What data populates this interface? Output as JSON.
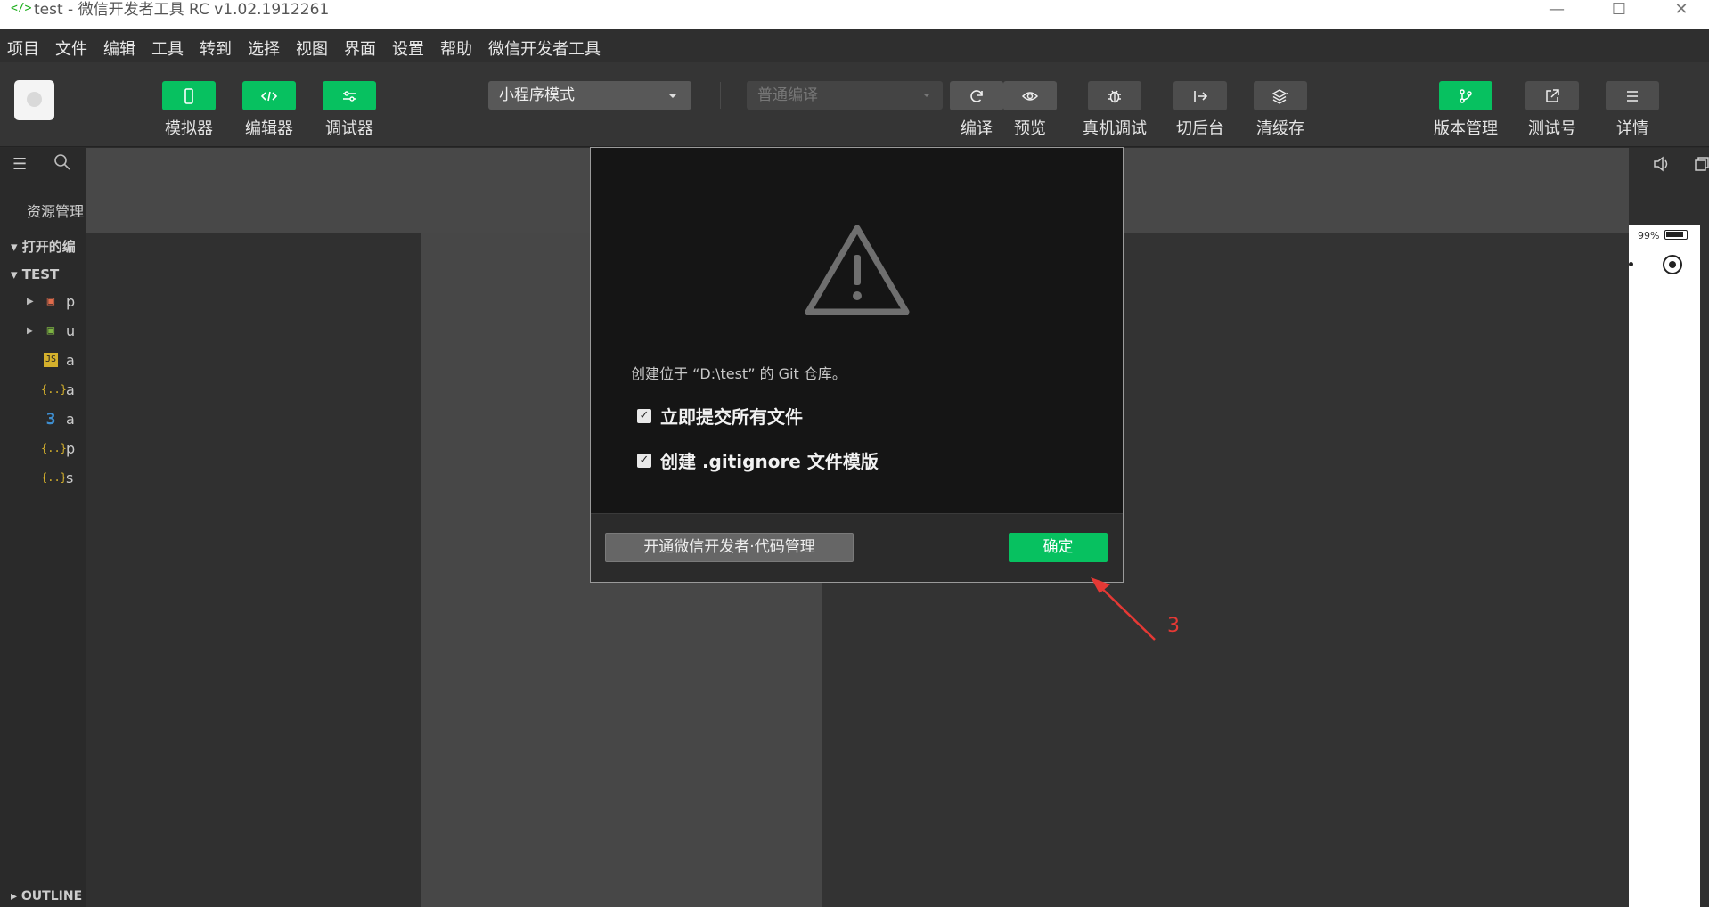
{
  "window": {
    "app_icon": "</>",
    "title": "test - 微信开发者工具 RC v1.02.1912261",
    "minimize": "—",
    "maximize": "☐",
    "close": "✕"
  },
  "menu": [
    "项目",
    "文件",
    "编辑",
    "工具",
    "转到",
    "选择",
    "视图",
    "界面",
    "设置",
    "帮助",
    "微信开发者工具"
  ],
  "toolbar": {
    "simulator_label": "模拟器",
    "editor_label": "编辑器",
    "debugger_label": "调试器",
    "mode_select": "小程序模式",
    "compile_select_placeholder": "普通编译",
    "compile_label": "编译",
    "preview_label": "预览",
    "remote_debug_label": "真机调试",
    "background_label": "切后台",
    "clear_cache_label": "清缓存",
    "version_label": "版本管理",
    "test_account_label": "测试号",
    "details_label": "详情"
  },
  "sidebar": {
    "title": "资源管理",
    "open_editors": "打开的编",
    "project": "TEST",
    "files": [
      {
        "arrow": "▶",
        "glyph": "▣",
        "color": "#e06c4c",
        "name": "p"
      },
      {
        "arrow": "▶",
        "glyph": "▣",
        "color": "#7cb342",
        "name": "u"
      },
      {
        "arrow": "",
        "glyph": "JS",
        "color": "#d4b02c",
        "name": "a"
      },
      {
        "arrow": "",
        "glyph": "{..}",
        "color": "#d4b02c",
        "name": "a"
      },
      {
        "arrow": "",
        "glyph": "3",
        "color": "#3e8ed0",
        "name": "a"
      },
      {
        "arrow": "",
        "glyph": "{..}",
        "color": "#d4b02c",
        "name": "p"
      },
      {
        "arrow": "",
        "glyph": "{..}",
        "color": "#d4b02c",
        "name": "s"
      }
    ],
    "outline": "OUTLINE"
  },
  "simulator": {
    "battery": "99%"
  },
  "dialog": {
    "message": "创建位于 “D:\\test” 的 Git 仓库。",
    "option1": "立即提交所有文件",
    "option1_checked": true,
    "option2": "创建 .gitignore 文件模版",
    "option2_checked": true,
    "secondary_button": "开通微信开发者·代码管理",
    "primary_button": "确定"
  },
  "annotation": {
    "number": "3",
    "color": "#e53935"
  },
  "colors": {
    "accent": "#07c160",
    "toolbar_bg": "#353535",
    "dialog_bg": "#151515"
  }
}
